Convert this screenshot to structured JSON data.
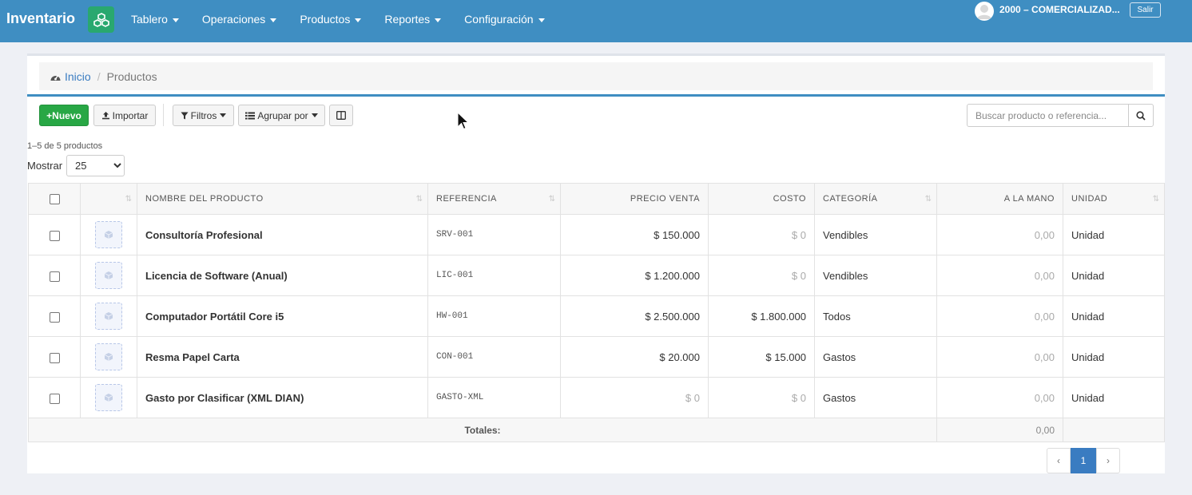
{
  "navbar": {
    "brand": "Inventario",
    "menu": [
      {
        "label": "Tablero"
      },
      {
        "label": "Operaciones"
      },
      {
        "label": "Productos"
      },
      {
        "label": "Reportes"
      },
      {
        "label": "Configuración"
      }
    ],
    "company": "2000 – COMERCIALIZAD...",
    "logout_label": "Salir"
  },
  "breadcrumb": {
    "home": "Inicio",
    "separator": "/",
    "current": "Productos"
  },
  "toolbar": {
    "new_label": "+Nuevo",
    "import_label": "Importar",
    "filters_label": "Filtros",
    "group_label": "Agrupar por",
    "search_placeholder": "Buscar producto o referencia..."
  },
  "listing": {
    "count_text": "1–5 de 5 productos",
    "show_label": "Mostrar",
    "page_size": "25"
  },
  "table": {
    "headers": {
      "name": "NOMBRE DEL PRODUCTO",
      "ref": "REFERENCIA",
      "price": "PRECIO VENTA",
      "cost": "COSTO",
      "category": "CATEGORÍA",
      "on_hand": "A LA MANO",
      "unit": "UNIDAD"
    },
    "rows": [
      {
        "name": "Consultoría Profesional",
        "ref": "SRV-001",
        "price": "$ 150.000",
        "cost": "$ 0",
        "category": "Vendibles",
        "on_hand": "0,00",
        "unit": "Unidad"
      },
      {
        "name": "Licencia de Software (Anual)",
        "ref": "LIC-001",
        "price": "$ 1.200.000",
        "cost": "$ 0",
        "category": "Vendibles",
        "on_hand": "0,00",
        "unit": "Unidad"
      },
      {
        "name": "Computador Portátil Core i5",
        "ref": "HW-001",
        "price": "$ 2.500.000",
        "cost": "$ 1.800.000",
        "category": "Todos",
        "on_hand": "0,00",
        "unit": "Unidad"
      },
      {
        "name": "Resma Papel Carta",
        "ref": "CON-001",
        "price": "$ 20.000",
        "cost": "$ 15.000",
        "category": "Gastos",
        "on_hand": "0,00",
        "unit": "Unidad"
      },
      {
        "name": "Gasto por Clasificar (XML DIAN)",
        "ref": "GASTO-XML",
        "price": "$ 0",
        "cost": "$ 0",
        "category": "Gastos",
        "on_hand": "0,00",
        "unit": "Unidad"
      }
    ],
    "totals_label": "Totales:",
    "totals_on_hand": "0,00"
  },
  "pagination": {
    "prev": "‹",
    "current": "1",
    "next": "›"
  },
  "colors": {
    "navbar": "#3f8ec2",
    "accent_green": "#28a745",
    "link_blue": "#3a7cc1"
  },
  "icons": [
    "cubes-icon",
    "tachometer-icon",
    "upload-icon",
    "filter-icon",
    "list-icon",
    "columns-icon",
    "search-icon",
    "cube-icon",
    "sort-icon",
    "avatar-icon"
  ]
}
